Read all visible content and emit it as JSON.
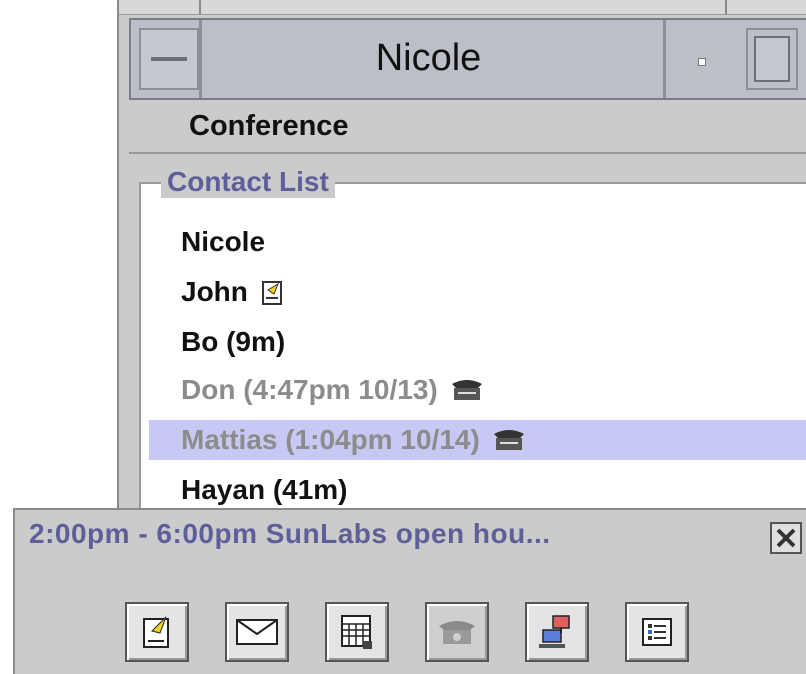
{
  "window": {
    "title": "Nicole",
    "menu": {
      "conference": "Conference"
    }
  },
  "contact_list": {
    "legend": "Contact List",
    "contacts": [
      {
        "text": "Nicole",
        "state": "online",
        "icon": null
      },
      {
        "text": "John",
        "state": "online",
        "icon": "note-icon"
      },
      {
        "text": "Bo (9m)",
        "state": "online",
        "icon": null
      },
      {
        "text": "Don (4:47pm 10/13)",
        "state": "away",
        "icon": "phone-icon"
      },
      {
        "text": "Mattias (1:04pm 10/14)",
        "state": "away",
        "icon": "phone-icon",
        "selected": true
      },
      {
        "text": "Hayan (41m)",
        "state": "online",
        "icon": null
      }
    ]
  },
  "notification": {
    "text": "2:00pm - 6:00pm SunLabs open hou..."
  },
  "toolbar": {
    "buttons": [
      {
        "name": "compose-note-icon"
      },
      {
        "name": "mail-icon"
      },
      {
        "name": "calendar-icon"
      },
      {
        "name": "phone-icon",
        "disabled": true
      },
      {
        "name": "share-screen-icon"
      },
      {
        "name": "details-list-icon"
      }
    ]
  },
  "colors": {
    "accent_text": "#5e5e99",
    "selected_row": "#c7c8f3",
    "titlebar": "#bcbec8"
  }
}
